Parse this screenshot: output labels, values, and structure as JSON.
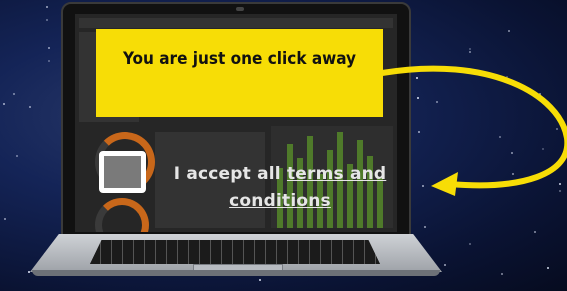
{
  "banner": {
    "text": "You are just one click away"
  },
  "consent": {
    "prefix": "I accept all ",
    "link_text": "terms and conditions",
    "checked": false
  },
  "colors": {
    "banner": "#f7dd06",
    "arrow": "#f7dd06",
    "checkbox_fill": "#7a7a7a",
    "background": "#0a1333"
  },
  "icons": {
    "pointer": "curved-arrow-icon"
  }
}
